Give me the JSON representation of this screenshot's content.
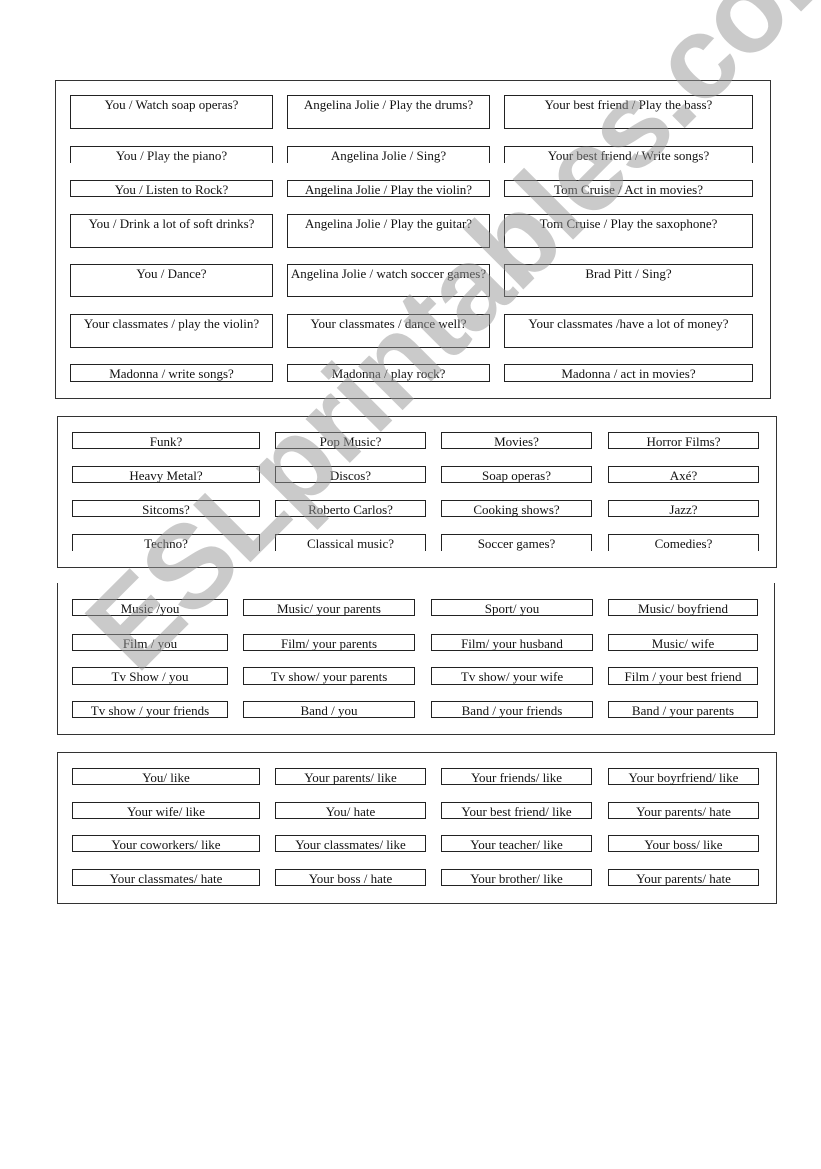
{
  "watermark": "ESLprintables.com",
  "section1": {
    "rows": [
      [
        "You / Watch soap operas?",
        "Angelina Jolie / Play the drums?",
        "Your best friend / Play the bass?"
      ],
      [
        "You / Play the piano?",
        "Angelina Jolie / Sing?",
        "Your best friend  / Write songs?"
      ],
      [
        "You / Listen to Rock?",
        "Angelina Jolie / Play the violin?",
        "Tom Cruise / Act in movies?"
      ],
      [
        "You / Drink a lot of soft drinks?",
        "Angelina Jolie / Play the guitar?",
        "Tom Cruise / Play the saxophone?"
      ],
      [
        "You / Dance?",
        "Angelina Jolie / watch soccer games?",
        "Brad Pitt / Sing?"
      ],
      [
        "Your classmates / play the violin?",
        "Your classmates / dance well?",
        "Your classmates /have a lot of money?"
      ],
      [
        "Madonna / write songs?",
        "Madonna / play rock?",
        "Madonna / act in movies?"
      ]
    ]
  },
  "section2": {
    "rows": [
      [
        "Funk?",
        "Pop Music?",
        "Movies?",
        "Horror Films?"
      ],
      [
        "Heavy Metal?",
        "Discos?",
        "Soap operas?",
        "Axé?"
      ],
      [
        "Sitcoms?",
        "Roberto Carlos?",
        "Cooking shows?",
        "Jazz?"
      ],
      [
        "Techno?",
        "Classical music?",
        "Soccer games?",
        "Comedies?"
      ]
    ]
  },
  "section3": {
    "rows": [
      [
        "Music /you",
        "Music/ your parents",
        "Sport/ you",
        "Music/ boyfriend"
      ],
      [
        "Film / you",
        "Film/ your parents",
        "Film/ your husband",
        "Music/ wife"
      ],
      [
        "Tv Show / you",
        "Tv show/ your parents",
        "Tv show/ your wife",
        "Film / your best friend"
      ],
      [
        "Tv show / your friends",
        "Band / you",
        "Band / your friends",
        "Band / your parents"
      ]
    ]
  },
  "section4": {
    "rows": [
      [
        "You/ like",
        "Your parents/ like",
        "Your friends/ like",
        "Your boyrfriend/ like"
      ],
      [
        "Your wife/ like",
        "You/ hate",
        "Your best friend/ like",
        "Your parents/ hate"
      ],
      [
        "Your coworkers/ like",
        "Your classmates/ like",
        "Your teacher/ like",
        "Your boss/ like"
      ],
      [
        "Your classmates/ hate",
        "Your boss / hate",
        "Your brother/ like",
        "Your parents/ hate"
      ]
    ]
  }
}
